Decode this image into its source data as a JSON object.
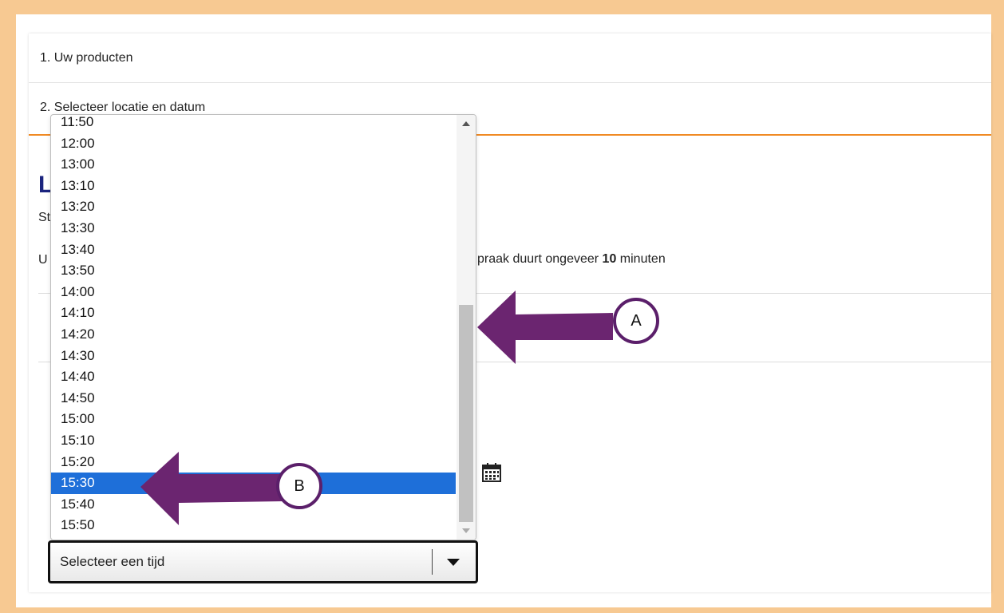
{
  "steps": {
    "step1": "1. Uw producten",
    "step2": "2. Selecteer locatie en datum"
  },
  "background_fragments": {
    "heading": "L",
    "subtext": "St",
    "info_prefix": "U",
    "info_suffix": "praak duurt ongeveer ",
    "info_duration": "10",
    "info_unit": " minuten"
  },
  "dropdown": {
    "options": [
      "11:50",
      "12:00",
      "13:00",
      "13:10",
      "13:20",
      "13:30",
      "13:40",
      "13:50",
      "14:00",
      "14:10",
      "14:20",
      "14:30",
      "14:40",
      "14:50",
      "15:00",
      "15:10",
      "15:20",
      "15:30",
      "15:40",
      "15:50"
    ],
    "selected": "15:30"
  },
  "select": {
    "placeholder": "Selecteer een tijd"
  },
  "annotations": {
    "a_label": "A",
    "b_label": "B",
    "arrow_color": "#6b2570"
  },
  "icons": {
    "calendar": "calendar-icon",
    "caret": "chevron-down-icon"
  }
}
